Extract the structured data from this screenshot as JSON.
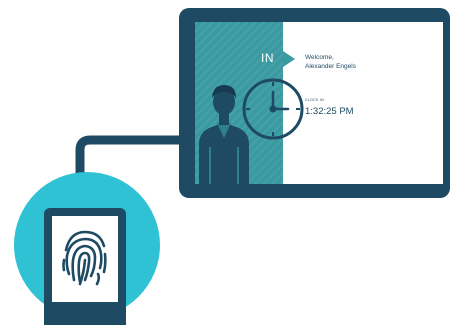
{
  "tablet": {
    "status_label": "IN",
    "welcome_line1": "Welcome,",
    "welcome_line2": "Alexander Engels",
    "clock_in_label": "CLOCK IN",
    "clock_time": "1:32:25 PM"
  },
  "icons": {
    "person": "person-icon",
    "clock": "clock-icon",
    "fingerprint": "fingerprint-icon"
  },
  "colors": {
    "dark_navy": "#1e4a63",
    "teal_panel": "#3a9aa1",
    "cyan_circle": "#2fc1d4",
    "background": "#ffffff"
  }
}
